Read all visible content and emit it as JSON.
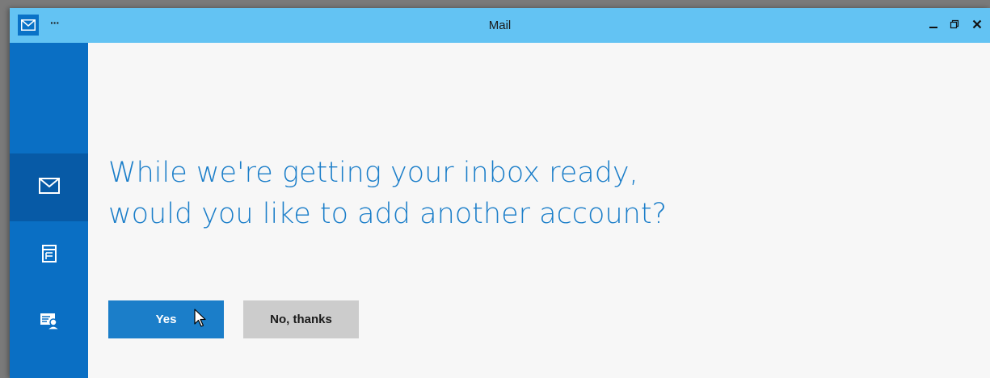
{
  "window": {
    "title": "Mail",
    "app_icon": "mail-envelope-icon",
    "menu_label": "···",
    "controls": [
      "minimize-icon",
      "restore-icon",
      "close-icon"
    ]
  },
  "sidebar": {
    "items": [
      {
        "name": "mail",
        "icon": "envelope-icon",
        "active": true
      },
      {
        "name": "calendar",
        "icon": "calendar-icon",
        "active": false
      },
      {
        "name": "people",
        "icon": "contact-card-icon",
        "active": false
      }
    ]
  },
  "main": {
    "headline_line1": "While we're getting your inbox ready,",
    "headline_line2": "would you like to add another account?",
    "yes_label": "Yes",
    "no_label": "No, thanks"
  },
  "colors": {
    "titlebar": "#63c3f3",
    "sidebar": "#0a6fc4",
    "sidebar_active": "#075aa6",
    "accent": "#1b7ec9",
    "background": "#f7f7f7",
    "secondary_button": "#cccccc"
  }
}
